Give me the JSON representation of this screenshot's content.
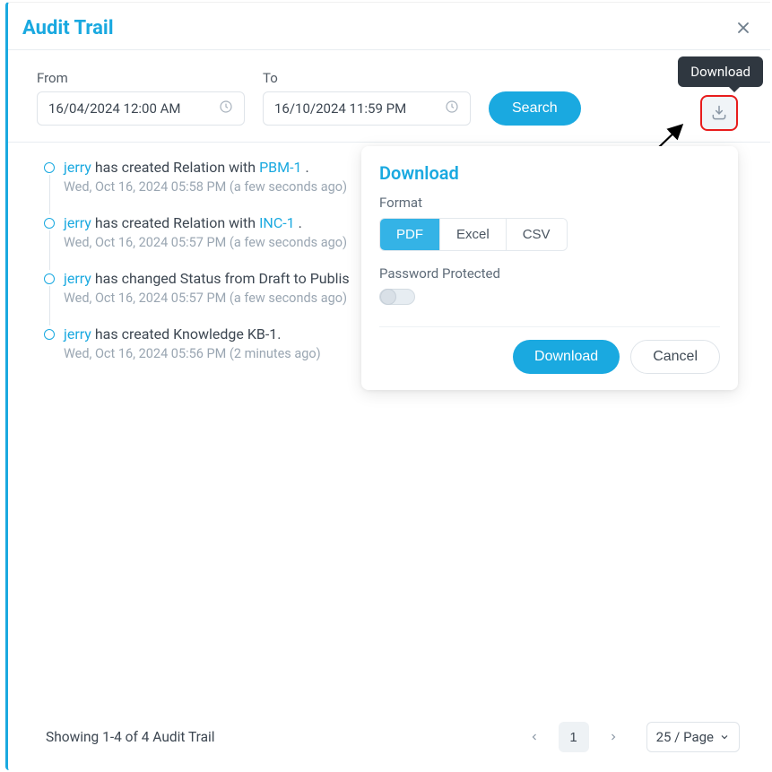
{
  "title": "Audit Trail",
  "filters": {
    "from_label": "From",
    "to_label": "To",
    "from_value": "16/04/2024 12:00 AM",
    "to_value": "16/10/2024 11:59 PM",
    "search_label": "Search"
  },
  "tooltip": {
    "download": "Download"
  },
  "popover": {
    "title": "Download",
    "format_label": "Format",
    "formats": {
      "pdf": "PDF",
      "excel": "Excel",
      "csv": "CSV"
    },
    "password_label": "Password Protected",
    "download": "Download",
    "cancel": "Cancel"
  },
  "entries": [
    {
      "user": "jerry",
      "mid": " has created Relation with ",
      "obj": "PBM-1",
      "after": " .",
      "meta": "Wed, Oct 16, 2024 05:58 PM (a few seconds ago)"
    },
    {
      "user": "jerry",
      "mid": " has created Relation with ",
      "obj": "INC-1",
      "after": " .",
      "meta": "Wed, Oct 16, 2024 05:57 PM (a few seconds ago)"
    },
    {
      "user": "jerry",
      "mid": " has changed Status from Draft to Publis",
      "obj": "",
      "after": "",
      "meta": "Wed, Oct 16, 2024 05:57 PM (a few seconds ago)"
    },
    {
      "user": "jerry",
      "mid": " has created Knowledge KB-1.",
      "obj": "",
      "after": "",
      "meta": "Wed, Oct 16, 2024 05:56 PM (2 minutes ago)"
    }
  ],
  "footer": {
    "showing": "Showing 1-4 of 4 Audit Trail",
    "page": "1",
    "page_size": "25 / Page"
  }
}
